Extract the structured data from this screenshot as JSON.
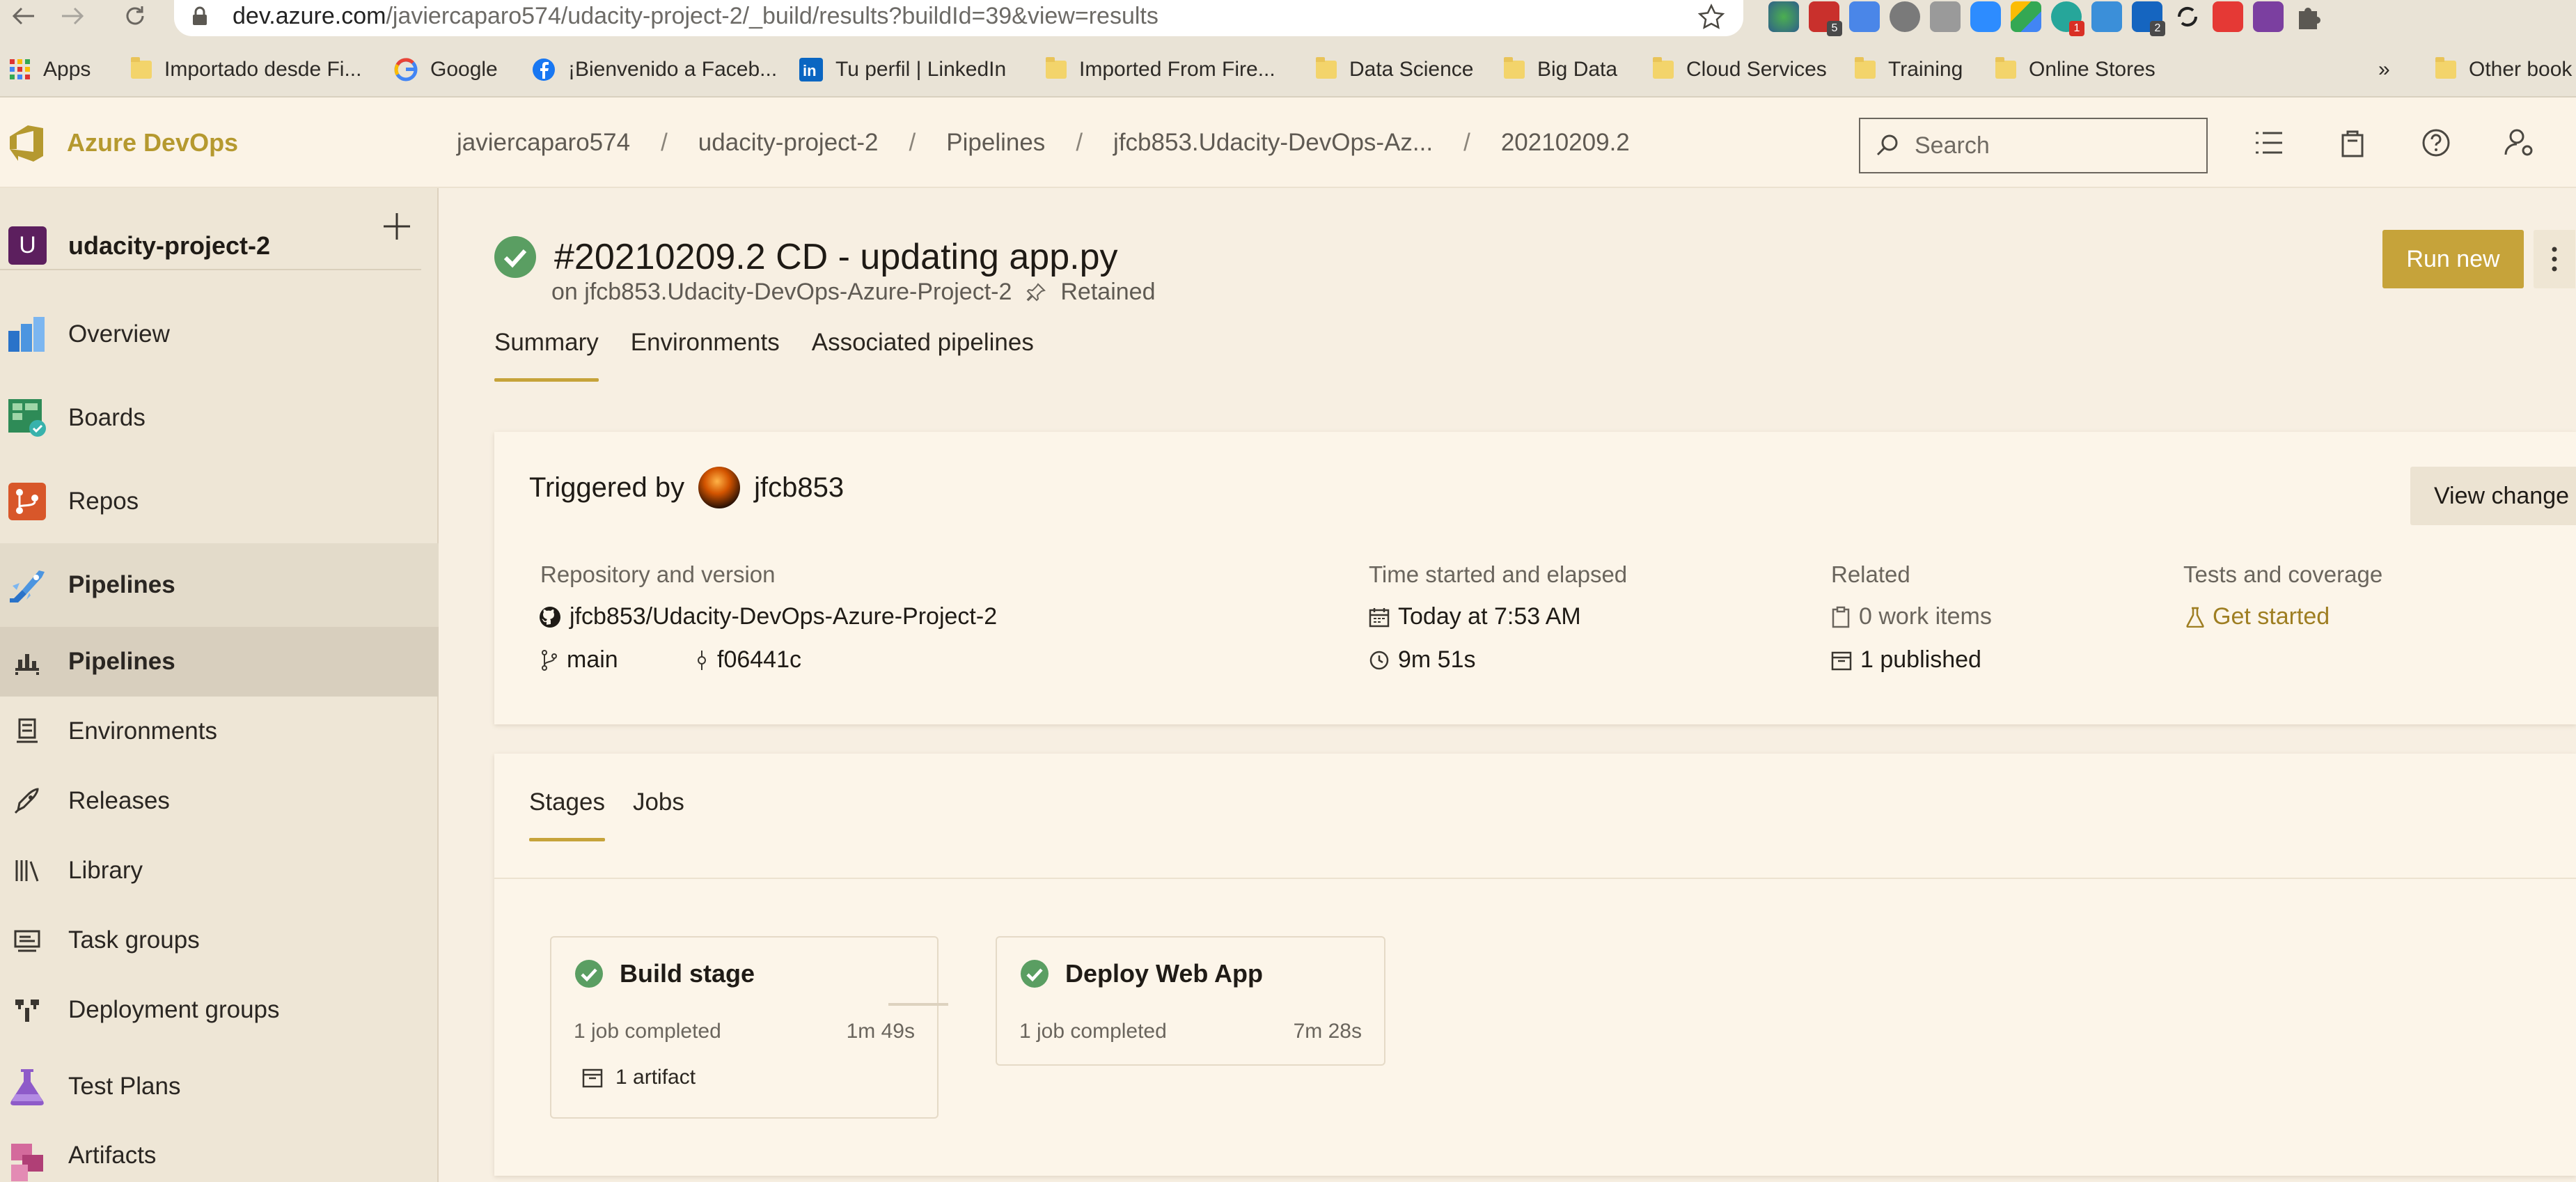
{
  "browser": {
    "url_host": "dev.azure.com",
    "url_path": "/javiercaparo574/udacity-project-2/_build/results?buildId=39&view=results",
    "extension_badges": [
      "5",
      "1",
      "2"
    ]
  },
  "bookmarks": [
    {
      "label": "Apps",
      "icon": "apps-grid-icon"
    },
    {
      "label": "Importado desde Fi...",
      "icon": "folder-icon"
    },
    {
      "label": "Google",
      "icon": "google-icon"
    },
    {
      "label": "¡Bienvenido a Faceb...",
      "icon": "facebook-icon"
    },
    {
      "label": "Tu perfil | LinkedIn",
      "icon": "linkedin-icon"
    },
    {
      "label": "Imported From Fire...",
      "icon": "folder-icon"
    },
    {
      "label": "Data Science",
      "icon": "folder-icon"
    },
    {
      "label": "Big Data",
      "icon": "folder-icon"
    },
    {
      "label": "Cloud Services",
      "icon": "folder-icon"
    },
    {
      "label": "Training",
      "icon": "folder-icon"
    },
    {
      "label": "Online Stores",
      "icon": "folder-icon"
    }
  ],
  "bookmarks_overflow": "»",
  "bookmarks_other": "Other book",
  "header": {
    "brand": "Azure DevOps",
    "breadcrumb": [
      "javiercaparo574",
      "udacity-project-2",
      "Pipelines",
      "jfcb853.Udacity-DevOps-Az...",
      "20210209.2"
    ],
    "breadcrumb_separator": "/",
    "search_placeholder": "Search"
  },
  "sidebar": {
    "project_initial": "U",
    "project_name": "udacity-project-2",
    "items": [
      {
        "label": "Overview",
        "icon": "overview-icon"
      },
      {
        "label": "Boards",
        "icon": "boards-icon"
      },
      {
        "label": "Repos",
        "icon": "repos-icon"
      },
      {
        "label": "Pipelines",
        "icon": "pipelines-icon"
      },
      {
        "label": "Pipelines",
        "icon": "pipelines-sub-icon"
      },
      {
        "label": "Environments",
        "icon": "environments-icon"
      },
      {
        "label": "Releases",
        "icon": "releases-icon"
      },
      {
        "label": "Library",
        "icon": "library-icon"
      },
      {
        "label": "Task groups",
        "icon": "task-groups-icon"
      },
      {
        "label": "Deployment groups",
        "icon": "deployment-groups-icon"
      },
      {
        "label": "Test Plans",
        "icon": "test-plans-icon"
      },
      {
        "label": "Artifacts",
        "icon": "artifacts-icon"
      }
    ]
  },
  "run": {
    "title": "#20210209.2 CD - updating app.py",
    "on_label": "on jfcb853.Udacity-DevOps-Azure-Project-2",
    "retained": "Retained",
    "run_new": "Run new",
    "tabs": [
      "Summary",
      "Environments",
      "Associated pipelines"
    ]
  },
  "summary": {
    "triggered_by_label": "Triggered by",
    "triggered_by_user": "jfcb853",
    "view_change": "View change",
    "repo_label": "Repository and version",
    "repo_name": "jfcb853/Udacity-DevOps-Azure-Project-2",
    "branch": "main",
    "commit": "f06441c",
    "time_label": "Time started and elapsed",
    "started": "Today at 7:53 AM",
    "elapsed": "9m 51s",
    "related_label": "Related",
    "work_items": "0 work items",
    "published": "1 published",
    "tests_label": "Tests and coverage",
    "tests_link": "Get started"
  },
  "stages": {
    "tabs": [
      "Stages",
      "Jobs"
    ],
    "items": [
      {
        "name": "Build stage",
        "jobs": "1 job completed",
        "duration": "1m 49s",
        "artifact": "1 artifact"
      },
      {
        "name": "Deploy Web App",
        "jobs": "1 job completed",
        "duration": "7m 28s"
      }
    ]
  },
  "colors": {
    "accent": "#c6a33a",
    "success": "#5a9e62",
    "brand": "#b5992f"
  }
}
